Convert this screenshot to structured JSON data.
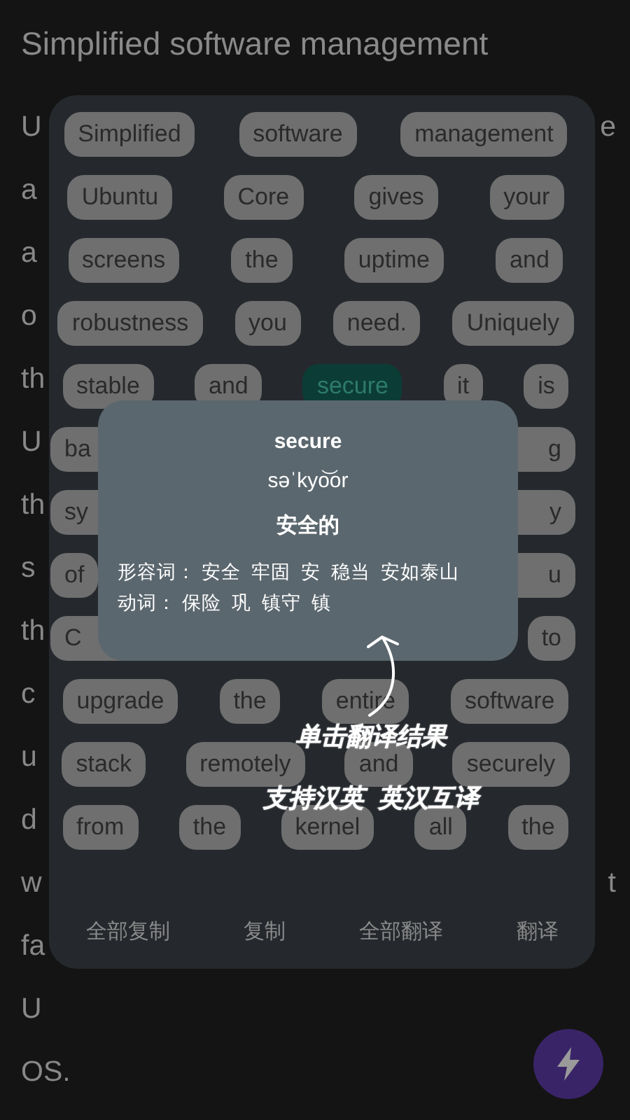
{
  "title": "Simplified software management",
  "article_lines": [
    {
      "left": "U",
      "right": "e"
    },
    {
      "left": "a"
    },
    {
      "left": "a"
    },
    {
      "left": "o"
    },
    {
      "left": "th"
    },
    {
      "left": "U"
    },
    {
      "left": "th"
    },
    {
      "left": "s"
    },
    {
      "left": "th"
    },
    {
      "left": "c"
    },
    {
      "left": "u"
    },
    {
      "left": "d"
    },
    {
      "left": "w",
      "right": "t"
    },
    {
      "left": "fa"
    },
    {
      "left": "U"
    },
    {
      "left": "OS."
    }
  ],
  "word_panel": {
    "rows": [
      [
        {
          "kind": "word",
          "text": "Simplified",
          "selected": false
        },
        {
          "kind": "word",
          "text": "software",
          "selected": false
        },
        {
          "kind": "word",
          "text": "management",
          "selected": false
        }
      ],
      [
        {
          "kind": "word",
          "text": "Ubuntu",
          "selected": false
        },
        {
          "kind": "word",
          "text": "Core",
          "selected": false
        },
        {
          "kind": "word",
          "text": "gives",
          "selected": false
        },
        {
          "kind": "word",
          "text": "your",
          "selected": false
        }
      ],
      [
        {
          "kind": "word",
          "text": "screens",
          "selected": false
        },
        {
          "kind": "word",
          "text": "the",
          "selected": false
        },
        {
          "kind": "word",
          "text": "uptime",
          "selected": false
        },
        {
          "kind": "word",
          "text": "and",
          "selected": false
        }
      ],
      [
        {
          "kind": "word",
          "text": "robustness",
          "selected": false
        },
        {
          "kind": "word",
          "text": "you",
          "selected": false
        },
        {
          "kind": "word",
          "text": "need.",
          "selected": false
        },
        {
          "kind": "word",
          "text": "Uniquely",
          "selected": false
        }
      ],
      [
        {
          "kind": "word",
          "text": "stable",
          "selected": false
        },
        {
          "kind": "word",
          "text": "and",
          "selected": false
        },
        {
          "kind": "word",
          "text": "secure",
          "selected": true
        },
        {
          "kind": "word",
          "text": "it",
          "selected": false
        },
        {
          "kind": "word",
          "text": "is",
          "selected": false
        }
      ],
      [
        {
          "kind": "cut_left",
          "text": "ba",
          "selected": false
        },
        {
          "kind": "cut_right",
          "text": "g",
          "selected": false
        }
      ],
      [
        {
          "kind": "cut_left",
          "text": "sy",
          "selected": false
        },
        {
          "kind": "cut_right",
          "text": "y",
          "selected": false
        }
      ],
      [
        {
          "kind": "word",
          "text": "of",
          "selected": false
        },
        {
          "kind": "cut_right",
          "text": "u",
          "selected": false
        }
      ],
      [
        {
          "kind": "cut_left",
          "text": "C",
          "selected": false
        },
        {
          "kind": "word",
          "text": "to",
          "selected": false
        }
      ],
      [
        {
          "kind": "word",
          "text": "upgrade",
          "selected": false
        },
        {
          "kind": "word",
          "text": "the",
          "selected": false
        },
        {
          "kind": "word",
          "text": "entire",
          "selected": false
        },
        {
          "kind": "word",
          "text": "software",
          "selected": false
        }
      ],
      [
        {
          "kind": "word",
          "text": "stack",
          "selected": false
        },
        {
          "kind": "word",
          "text": "remotely",
          "selected": false
        },
        {
          "kind": "word",
          "text": "and",
          "selected": false
        },
        {
          "kind": "word",
          "text": "securely",
          "selected": false
        }
      ],
      [
        {
          "kind": "word",
          "text": "from",
          "selected": false
        },
        {
          "kind": "word",
          "text": "the",
          "selected": false
        },
        {
          "kind": "word",
          "text": "kernel",
          "selected": false
        },
        {
          "kind": "word",
          "text": "all",
          "selected": false
        },
        {
          "kind": "word",
          "text": "the",
          "selected": false
        }
      ]
    ],
    "actions": [
      "全部复制",
      "复制",
      "全部翻译",
      "翻译"
    ]
  },
  "popup": {
    "word": "secure",
    "phonetic": "səˈkyo͝or",
    "meaning": "安全的",
    "definitions": [
      "形容词： 安全  牢固  安  稳当  安如泰山",
      "动词： 保险  巩  镇守  镇"
    ]
  },
  "hint": [
    "单击翻译结果",
    "支持汉英  英汉互译"
  ]
}
